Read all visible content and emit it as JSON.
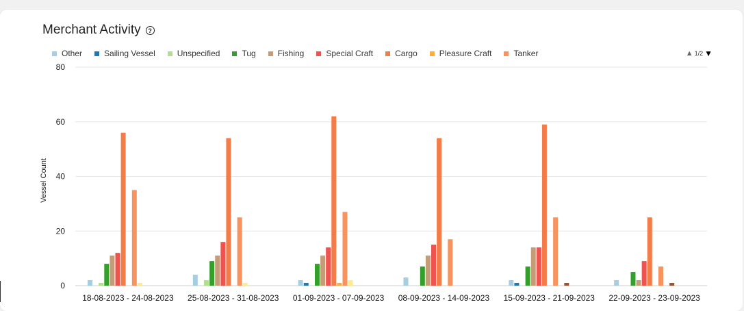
{
  "header": {
    "title": "Merchant Activity",
    "help_icon": "question-circle-icon"
  },
  "pager": {
    "label": "1/2",
    "up_icon": "▲",
    "down_icon": "▼"
  },
  "chart_data": {
    "type": "bar",
    "ylabel": "Vessel Count",
    "xlabel": "",
    "ylim": [
      0,
      80
    ],
    "yticks": [
      "0",
      "20",
      "40",
      "60",
      "80"
    ],
    "legend_position": "top",
    "grid": true,
    "categories": [
      "18-08-2023 - 24-08-2023",
      "25-08-2023 - 31-08-2023",
      "01-09-2023 - 07-09-2023",
      "08-09-2023 - 14-09-2023",
      "15-09-2023 - 21-09-2023",
      "22-09-2023 - 23-09-2023"
    ],
    "series": [
      {
        "name": "Other",
        "color": "#a6cee3",
        "values": [
          2,
          4,
          2,
          3,
          2,
          2
        ]
      },
      {
        "name": "Sailing Vessel",
        "color": "#1f78b4",
        "values": [
          0,
          0,
          1,
          0,
          1,
          0
        ]
      },
      {
        "name": "Unspecified",
        "color": "#b2df8a",
        "values": [
          1,
          2,
          0,
          0,
          0,
          0
        ]
      },
      {
        "name": "Tug",
        "color": "#33a02c",
        "values": [
          8,
          9,
          8,
          7,
          7,
          5
        ]
      },
      {
        "name": "Fishing",
        "color": "#c49c78",
        "values": [
          11,
          11,
          11,
          11,
          14,
          2
        ]
      },
      {
        "name": "Special Craft",
        "color": "#ef5350",
        "values": [
          12,
          16,
          14,
          15,
          14,
          9
        ]
      },
      {
        "name": "Cargo",
        "color": "#f47c48",
        "values": [
          56,
          54,
          62,
          54,
          59,
          25
        ]
      },
      {
        "name": "Pleasure Craft",
        "color": "#fdae3b",
        "values": [
          0,
          0,
          1,
          0,
          0,
          0
        ]
      },
      {
        "name": "Tanker",
        "color": "#f7935f",
        "values": [
          35,
          25,
          27,
          17,
          25,
          7
        ]
      },
      {
        "name": "",
        "color": "#ffeb8a",
        "values": [
          1,
          1,
          2,
          0,
          0,
          0
        ]
      },
      {
        "name": "",
        "color": "#a0522d",
        "values": [
          0,
          0,
          0,
          0,
          1,
          1
        ]
      }
    ]
  }
}
